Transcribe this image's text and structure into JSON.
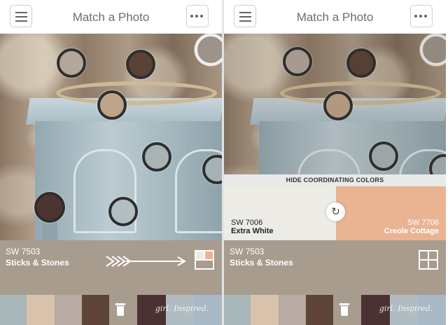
{
  "header": {
    "title": "Match a Photo",
    "menu_icon": "hamburger-menu-icon",
    "more_icon": "more-dots-icon"
  },
  "left": {
    "photo_swatches": [
      {
        "color": "#b3a79c"
      },
      {
        "color": "#5a4237"
      },
      {
        "color": "#bfa48a"
      },
      {
        "color": "#a7b4b3"
      },
      {
        "color": "#b1bec2"
      },
      {
        "color": "#4c3430"
      },
      {
        "color": "#a6b2b5"
      },
      {
        "color": "#9d9389"
      }
    ],
    "selected": {
      "code": "SW 7503",
      "name": "Sticks & Stones",
      "color": "#a89c8f"
    },
    "palette": [
      {
        "color": "#a9b7ba"
      },
      {
        "color": "#d9c3ac"
      },
      {
        "color": "#b7aba3"
      },
      {
        "color": "#5e4337"
      }
    ],
    "palette_right": [
      {
        "color": "#4b3232"
      },
      {
        "color": "#afbcc1"
      },
      {
        "color": "#a7b8c6"
      }
    ],
    "watermark": "girl. Inspired."
  },
  "right": {
    "hide_label": "HIDE COORDINATING COLORS",
    "coord_left": {
      "code": "SW 7006",
      "name": "Extra White",
      "color": "#ecebe6"
    },
    "coord_right": {
      "code": "SW 7706",
      "name": "Creole Cottage",
      "color": "#e9b492"
    },
    "selected": {
      "code": "SW 7503",
      "name": "Sticks & Stones",
      "color": "#a89c8f"
    }
  }
}
